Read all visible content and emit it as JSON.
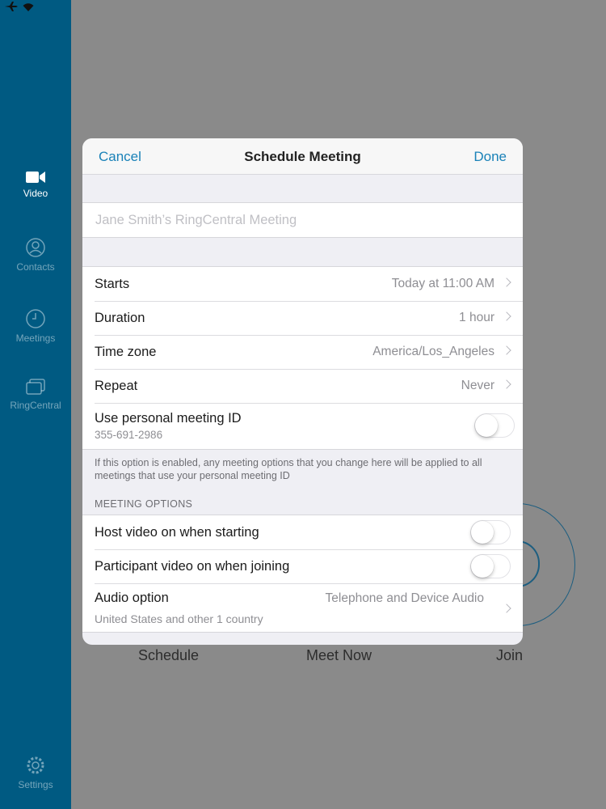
{
  "sidebar": {
    "items": [
      {
        "label": "Video",
        "icon": "video-camera-icon",
        "active": true
      },
      {
        "label": "Contacts",
        "icon": "contacts-icon",
        "active": false
      },
      {
        "label": "Meetings",
        "icon": "clock-icon",
        "active": false
      },
      {
        "label": "RingCentral",
        "icon": "chat-bubbles-icon",
        "active": false
      }
    ],
    "settings_label": "Settings"
  },
  "background": {
    "schedule_label": "Schedule",
    "meet_now_label": "Meet Now",
    "join_label": "Join"
  },
  "modal": {
    "cancel_label": "Cancel",
    "title": "Schedule Meeting",
    "done_label": "Done",
    "topic_placeholder": "Jane Smith’s RingCentral Meeting",
    "rows": {
      "starts": {
        "label": "Starts",
        "value": "Today at 11:00 AM"
      },
      "duration": {
        "label": "Duration",
        "value": "1 hour"
      },
      "timezone": {
        "label": "Time zone",
        "value": "America/Los_Angeles"
      },
      "repeat": {
        "label": "Repeat",
        "value": "Never"
      },
      "personal_id": {
        "label": "Use personal meeting ID",
        "id": "355-691-2986"
      }
    },
    "note": "If this option is enabled, any meeting options that you change here will be applied to all meetings that use your personal meeting ID",
    "options_header": "MEETING OPTIONS",
    "options": {
      "host_video": {
        "label": "Host video on when starting"
      },
      "participant_video": {
        "label": "Participant video on when joining"
      },
      "audio": {
        "label": "Audio option",
        "value": "Telephone and Device Audio",
        "sub": "United States and other 1 country"
      }
    }
  },
  "colors": {
    "sidebar_bg": "#005a82",
    "accent": "#1a82b8",
    "backdrop": "#8a8a8a"
  }
}
